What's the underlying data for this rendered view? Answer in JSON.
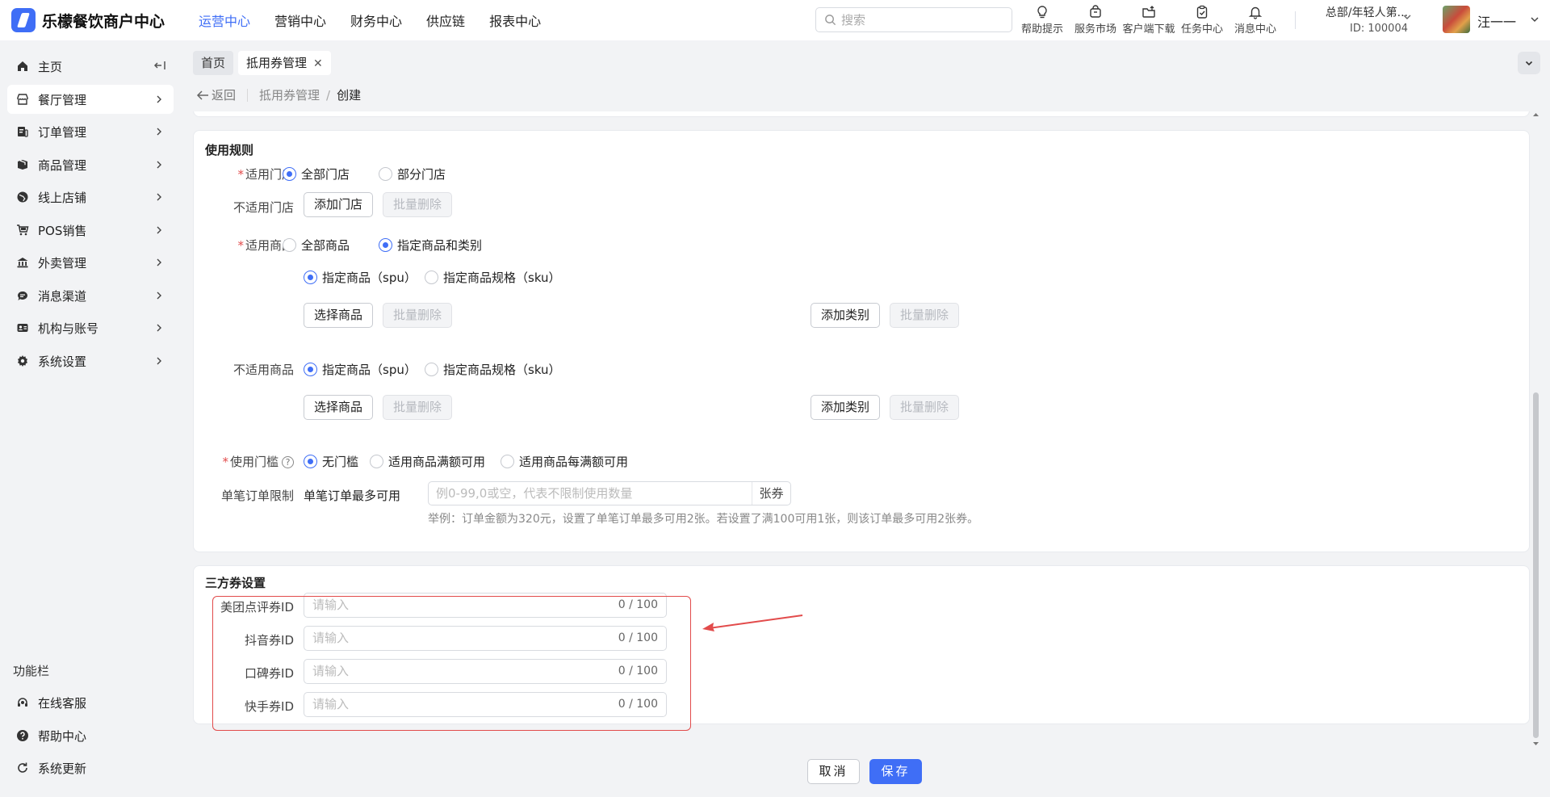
{
  "app": {
    "title": "乐檬餐饮商户中心"
  },
  "topnav": {
    "items": [
      "运营中心",
      "营销中心",
      "财务中心",
      "供应链",
      "报表中心"
    ],
    "active": 0
  },
  "search": {
    "placeholder": "搜索"
  },
  "tools": [
    {
      "label": "帮助提示",
      "icon": "bulb-icon"
    },
    {
      "label": "服务市场",
      "icon": "store-bag-icon"
    },
    {
      "label": "客户端下载",
      "icon": "folder-upload-icon"
    },
    {
      "label": "任务中心",
      "icon": "clipboard-icon"
    },
    {
      "label": "消息中心",
      "icon": "bell-icon"
    }
  ],
  "org": {
    "name": "总部/年轻人第...",
    "id": "ID: 100004"
  },
  "user": {
    "name": "汪一一"
  },
  "sidebar": {
    "items": [
      {
        "label": "主页",
        "icon": "home-icon"
      },
      {
        "label": "餐厅管理",
        "icon": "restaurant-icon"
      },
      {
        "label": "订单管理",
        "icon": "order-icon"
      },
      {
        "label": "商品管理",
        "icon": "box-icon"
      },
      {
        "label": "线上店铺",
        "icon": "globe-icon"
      },
      {
        "label": "POS销售",
        "icon": "cart-icon"
      },
      {
        "label": "外卖管理",
        "icon": "bank-icon"
      },
      {
        "label": "消息渠道",
        "icon": "chat-icon"
      },
      {
        "label": "机构与账号",
        "icon": "id-card-icon"
      },
      {
        "label": "系统设置",
        "icon": "gear-icon"
      }
    ],
    "active": 1,
    "func_title": "功能栏",
    "func_items": [
      {
        "label": "在线客服",
        "icon": "headset-icon"
      },
      {
        "label": "帮助中心",
        "icon": "question-icon"
      },
      {
        "label": "系统更新",
        "icon": "refresh-icon"
      }
    ]
  },
  "tabs": [
    {
      "label": "首页"
    },
    {
      "label": "抵用券管理",
      "closable": true
    }
  ],
  "breadcrumb": {
    "back": "返回",
    "parent": "抵用券管理",
    "current": "创建"
  },
  "rules": {
    "title": "使用规则",
    "applicable_stores": {
      "label": "适用门店",
      "options": [
        "全部门店",
        "部分门店"
      ],
      "selected": 0
    },
    "excluded_stores": {
      "label": "不适用门店",
      "add": "添加门店",
      "bulk_delete": "批量删除"
    },
    "applicable_goods": {
      "label": "适用商品",
      "options": [
        "全部商品",
        "指定商品和类别"
      ],
      "selected": 1
    },
    "goods_mode": {
      "options": [
        "指定商品（spu）",
        "指定商品规格（sku）"
      ],
      "selected": 0
    },
    "goods_buttons": {
      "select": "选择商品",
      "bulk_delete": "批量删除",
      "add_category": "添加类别",
      "bulk_delete_2": "批量删除"
    },
    "excluded_goods": {
      "label": "不适用商品",
      "options": [
        "指定商品（spu）",
        "指定商品规格（sku）"
      ],
      "selected": 0
    },
    "excluded_buttons": {
      "select": "选择商品",
      "bulk_delete": "批量删除",
      "add_category": "添加类别",
      "bulk_delete_2": "批量删除"
    },
    "threshold": {
      "label": "使用门槛",
      "options": [
        "无门槛",
        "适用商品满额可用",
        "适用商品每满额可用"
      ],
      "selected": 0
    },
    "order_limit": {
      "label": "单笔订单限制",
      "sub_label": "单笔订单最多可用",
      "placeholder": "例0-99,0或空，代表不限制使用数量",
      "suffix": "张券",
      "hint": "举例：订单金额为320元，设置了单笔订单最多可用2张。若设置了满100可用1张，则该订单最多可用2张券。"
    }
  },
  "third_party": {
    "title": "三方券设置",
    "fields": [
      {
        "label": "美团点评券ID",
        "placeholder": "请输入",
        "count": "0 / 100"
      },
      {
        "label": "抖音券ID",
        "placeholder": "请输入",
        "count": "0 / 100"
      },
      {
        "label": "口碑券ID",
        "placeholder": "请输入",
        "count": "0 / 100"
      },
      {
        "label": "快手券ID",
        "placeholder": "请输入",
        "count": "0 / 100"
      }
    ]
  },
  "footer": {
    "cancel": "取消",
    "save": "保存"
  },
  "colors": {
    "primary": "#3f6ef6",
    "required": "#e24b4b",
    "annotation": "#e24b4b"
  }
}
